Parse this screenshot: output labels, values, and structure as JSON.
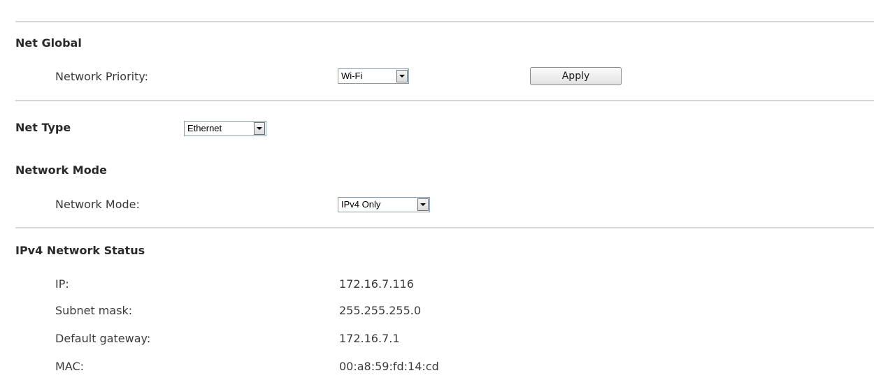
{
  "net_global": {
    "title": "Net Global",
    "priority_label": "Network Priority:",
    "priority_value": "Wi-Fi",
    "apply_label": "Apply"
  },
  "net_type": {
    "title": "Net Type",
    "value": "Ethernet"
  },
  "network_mode": {
    "title": "Network Mode",
    "mode_label": "Network Mode:",
    "mode_value": "IPv4 Only"
  },
  "ipv4_status": {
    "title": "IPv4 Network Status",
    "rows": [
      {
        "label": "IP:",
        "value": "172.16.7.116"
      },
      {
        "label": "Subnet mask:",
        "value": "255.255.255.0"
      },
      {
        "label": "Default gateway:",
        "value": "172.16.7.1"
      },
      {
        "label": "MAC:",
        "value": "00:a8:59:fd:14:cd"
      }
    ]
  }
}
